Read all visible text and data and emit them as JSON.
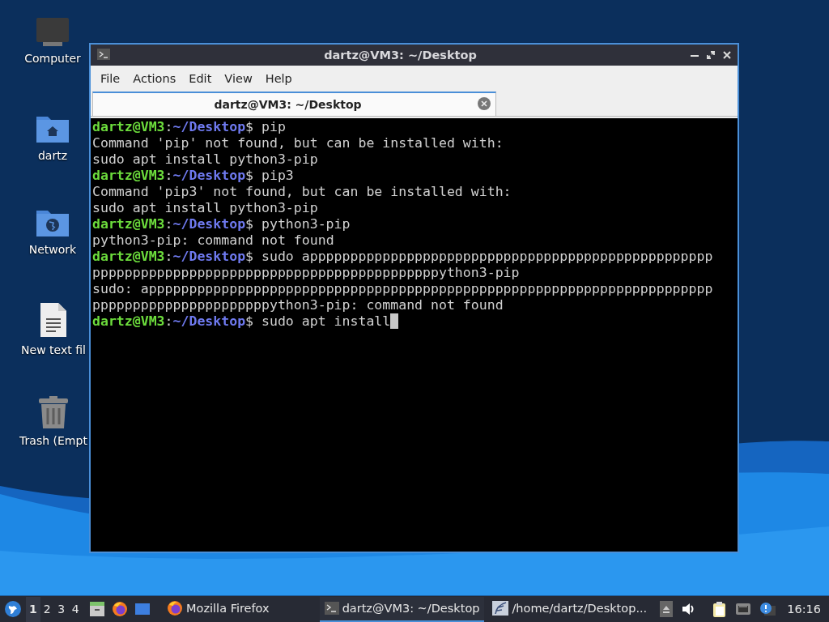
{
  "desktop_icons": [
    {
      "label": "Computer",
      "kind": "computer"
    },
    {
      "label": "dartz",
      "kind": "home"
    },
    {
      "label": "Network",
      "kind": "network"
    },
    {
      "label": "New text fil",
      "kind": "document"
    },
    {
      "label": "Trash (Empt",
      "kind": "trash"
    }
  ],
  "window": {
    "title": "dartz@VM3: ~/Desktop",
    "menu": [
      "File",
      "Actions",
      "Edit",
      "View",
      "Help"
    ],
    "tabs": [
      {
        "label": "dartz@VM3: ~/Desktop",
        "selected": true
      }
    ],
    "terminal": {
      "lines": [
        {
          "kind": "prompt",
          "user": "dartz@VM3",
          "sep": ":",
          "path": "~/Desktop",
          "symbol": "$",
          "command": "pip"
        },
        {
          "kind": "output",
          "text": "Command 'pip' not found, but can be installed with:"
        },
        {
          "kind": "output",
          "text": "sudo apt install python3-pip"
        },
        {
          "kind": "prompt",
          "user": "dartz@VM3",
          "sep": ":",
          "path": "~/Desktop",
          "symbol": "$",
          "command": "pip3"
        },
        {
          "kind": "output",
          "text": "Command 'pip3' not found, but can be installed with:"
        },
        {
          "kind": "output",
          "text": "sudo apt install python3-pip"
        },
        {
          "kind": "prompt",
          "user": "dartz@VM3",
          "sep": ":",
          "path": "~/Desktop",
          "symbol": "$",
          "command": "python3-pip"
        },
        {
          "kind": "output",
          "text": "python3-pip: command not found"
        },
        {
          "kind": "prompt",
          "user": "dartz@VM3",
          "sep": ":",
          "path": "~/Desktop",
          "symbol": "$",
          "command": "sudo apppppppppppppppppppppppppppppppppppppppppppppppppp"
        },
        {
          "kind": "output",
          "text": "pppppppppppppppppppppppppppppppppppppppppppython3-pip"
        },
        {
          "kind": "output",
          "text": "sudo: apppppppppppppppppppppppppppppppppppppppppppppppppppppppppppppppppppppp"
        },
        {
          "kind": "output",
          "text": "ppppppppppppppppppppppython3-pip: command not found"
        },
        {
          "kind": "prompt",
          "user": "dartz@VM3",
          "sep": ":",
          "path": "~/Desktop",
          "symbol": "$",
          "command": "sudo apt install",
          "cursor": true
        }
      ]
    }
  },
  "taskbar": {
    "workspaces": [
      {
        "label": "1",
        "selected": true
      },
      {
        "label": "2",
        "selected": false
      },
      {
        "label": "3",
        "selected": false
      },
      {
        "label": "4",
        "selected": false
      }
    ],
    "launchers": [
      {
        "kind": "files"
      },
      {
        "kind": "firefox"
      },
      {
        "kind": "desktop"
      }
    ],
    "tasks": [
      {
        "label": "Mozilla Firefox",
        "kind": "firefox",
        "selected": false
      },
      {
        "label": "dartz@VM3: ~/Desktop",
        "kind": "terminal",
        "selected": true
      },
      {
        "label": "/home/dartz/Desktop...",
        "kind": "editor",
        "selected": false
      }
    ],
    "tray": [
      {
        "kind": "eject"
      },
      {
        "kind": "volume"
      },
      {
        "kind": "clipboard"
      },
      {
        "kind": "network"
      },
      {
        "kind": "notification"
      }
    ],
    "clock": "16:16"
  }
}
